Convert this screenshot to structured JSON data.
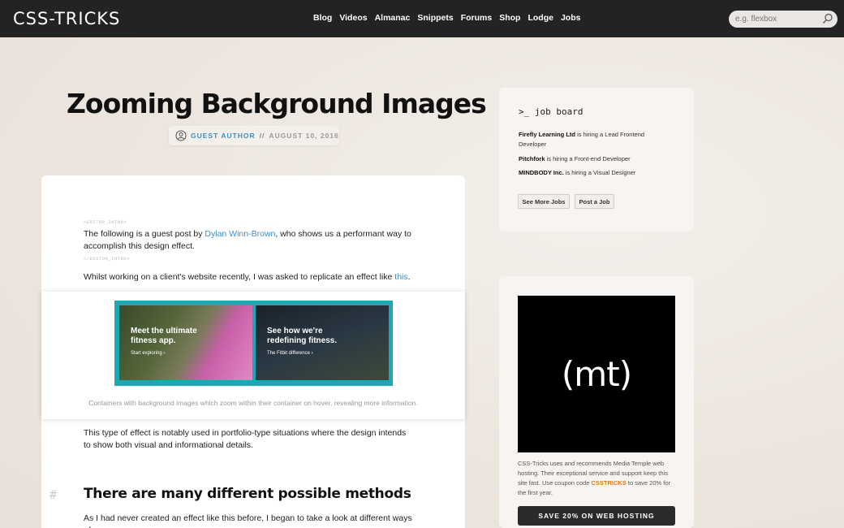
{
  "header": {
    "logo": "CSS-TRICKS",
    "nav": [
      "Blog",
      "Videos",
      "Almanac",
      "Snippets",
      "Forums",
      "Shop",
      "Lodge",
      "Jobs"
    ],
    "search_placeholder": "e.g. flexbox"
  },
  "article": {
    "title": "Zooming Background Images",
    "author": "GUEST AUTHOR",
    "separator": "//",
    "date": "AUGUST 10, 2016",
    "editor_intro_open": "<EDITOR_INTRO>",
    "editor_intro_close": "</EDITOR_INTRO>",
    "intro_before": "The following is a guest post by ",
    "intro_link": "Dylan Winn-Brown",
    "intro_after": ", who shows us a performant way to accomplish this design effect.",
    "para1_before": "Whilst working on a client's website recently, I was asked to replicate an effect like ",
    "para1_link": "this",
    "para1_after": ".",
    "figure": {
      "left_heading": "Meet the ultimate fitness app.",
      "left_link": "Start exploring",
      "right_heading": "See how we're redefining fitness.",
      "right_link": "The Fitbit difference"
    },
    "caption": "Containers with background images which zoom within their container on hover, revealing more information.",
    "para2": "This type of effect is notably used in portfolio-type situations where the design intends to show both visual and informational details.",
    "h2": "There are many different possible methods",
    "para3": "As I had never created an effect like this before, I began to take a look at different ways of"
  },
  "jobboard": {
    "title": ">_ job board",
    "jobs": [
      {
        "company": "Firefly Learning Ltd",
        "text": " is hiring a Lead Frontend Developer"
      },
      {
        "company": "Pitchfork",
        "text": " is hiring a Front-end Developer"
      },
      {
        "company": "MINDBODY Inc.",
        "text": " is hiring a Visual Designer"
      }
    ],
    "more_button": "See More Jobs",
    "post_button": "Post a Job"
  },
  "ad": {
    "logo_text": "(mt)",
    "text_before": "CSS-Tricks uses and recommends Media Temple web hosting. Their exceptional service and support keep this site fast. Use coupon code ",
    "coupon": "CSSTRICKS",
    "text_after": " to save 20% for the first year.",
    "button": "SAVE 20% ON WEB HOSTING"
  }
}
